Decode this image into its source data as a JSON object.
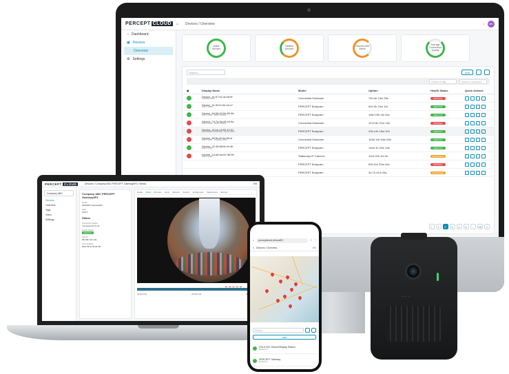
{
  "monitor": {
    "logo_main": "PERCEPT",
    "logo_box": "CLOUD",
    "breadcrumb": "Devices / Overview",
    "avatar": "MK",
    "sidebar": [
      {
        "label": "Dashboard"
      },
      {
        "label": "Devices"
      },
      {
        "label": "Overview"
      },
      {
        "label": "Settings"
      }
    ],
    "cards": [
      {
        "label": "Online Devices",
        "color": "#3fb54a"
      },
      {
        "label": "Healthy Devices",
        "color": "#f0932b"
      },
      {
        "label": "Devices with Alerts",
        "color": "#f0932b"
      },
      {
        "label": "Average Connection Quality",
        "color": "#3fb54a"
      }
    ],
    "search_placeholder": "Search...",
    "add_label": "Add",
    "filter1": "Select a tag",
    "filter2": "Select a product",
    "columns": [
      "Display Name",
      "Model",
      "Uptime",
      "Health Status",
      "Quick Actions"
    ],
    "rows": [
      {
        "name": "Device_e1:67:b1:ad:af:9f",
        "tag": "LOADING DOCK",
        "model": "Connected Dashcam",
        "uptime": "75d 4h 13m 25s",
        "health": "CRITICAL",
        "state": "ok"
      },
      {
        "name": "Device_9c:3f:e3:4e:c8:c7",
        "tag": "NIGHT SHIFT",
        "model": "PERCEPT Bodycam",
        "uptime": "62d 3h 24m 11s",
        "health": "HEALTHY",
        "state": "ok"
      },
      {
        "name": "Device_9d:56:04:5e:82:8b",
        "tag": "NIGHT SHIFT · NIGHT PATROL",
        "model": "PERCEPT Bodycam",
        "uptime": "116d 19h 4m 44s",
        "health": "HEALTHY",
        "state": "ok"
      },
      {
        "name": "Device_7d:7a:3a:d9:c0:9a",
        "tag": "NIGHT SHIFT · NIGHT PATROL",
        "model": "Connected Dashcam",
        "uptime": "107d 6h 21m 15s",
        "health": "CRITICAL",
        "state": "bad"
      },
      {
        "name": "Device_cb:1e:c3:83:10:31",
        "tag": "SECONDARY ENTRANCE · NIGHT SHIFT",
        "model": "PERCEPT Bodycam",
        "uptime": "23d 14h 15m 57s",
        "health": "HEALTHY",
        "state": "bad"
      },
      {
        "name": "Device_89:9a:f2:0a:f8:cd",
        "tag": "NIGHT SHIFT · LOADING DOCK",
        "model": "Connected Dashcam",
        "uptime": "104d 11h 54m 53s",
        "health": "HEALTHY",
        "state": "bad"
      },
      {
        "name": "Device_42:48:68:8c:fe:4b",
        "tag": "NIGHT SHIFT",
        "model": "PERCEPT Bodycam",
        "uptime": "134d 1h 22m 44s",
        "health": "HEALTHY",
        "state": "ok"
      },
      {
        "name": "Device_1a:a8:0a:52:38:96",
        "tag": "NIGHT SHIFT",
        "model": "Stationary IP Camera",
        "uptime": "111d 20h 2m 9s",
        "health": "DEGRADED",
        "state": "bad"
      },
      {
        "name": "",
        "tag": "",
        "model": "PERCEPT Bodycam",
        "uptime": "63d 11h 52m 44s",
        "health": "CRITICAL",
        "state": "none"
      },
      {
        "name": "",
        "tag": "",
        "model": "PERCEPT Bodycam",
        "uptime": "2d 7h 41m 25s",
        "health": "DEGRADED",
        "state": "none"
      }
    ],
    "pages": [
      "<",
      "1",
      "2",
      "3",
      "4",
      "5",
      "...",
      "25",
      ">"
    ],
    "health_colors": {
      "HEALTHY": "#3fb54a",
      "CRITICAL": "#e24a4a",
      "DEGRADED": "#f0a020"
    }
  },
  "laptop": {
    "breadcrumb": "Devices / Company ABC PERCEPT Gateway9F3 / Media",
    "avatar": "SN",
    "company": "Company ABC",
    "sidebar": [
      "Devices",
      "Overview",
      "Tags",
      "Video",
      "Settings"
    ],
    "device_title": "Company ABC PERCEPT Gateway9F3",
    "info_heading": "Status",
    "info": [
      {
        "k": "Model",
        "v": "PERCEPT Gateway9F3"
      },
      {
        "k": "Tags",
        "v": "VAULT"
      },
      {
        "k": "Connection Status",
        "v": "Connected for 5h 13"
      },
      {
        "k": "Health Status",
        "v": "HEALTHY"
      },
      {
        "k": "Uptime",
        "v": "08d 08h 22m 44s"
      },
      {
        "k": "Last updated",
        "v": "2024-05-01 09:46 PM"
      }
    ],
    "tabs": [
      "Details",
      "Media",
      "Firmware",
      "Alerts",
      "Statistics",
      "Network",
      "Configuration",
      "Maintenance",
      "Settings"
    ],
    "timeline": [
      "08:46:30 AM",
      "08:46:40 AM",
      "08:46:50 AM"
    ]
  },
  "phone": {
    "url": "perceptcloud.iefnoutEC",
    "breadcrumb": "Devices / Overview",
    "avatar": "MK",
    "search_placeholder": "Search...",
    "add_label": "Add",
    "devices": [
      {
        "name": "CIN-9-30V Secure/Display Station",
        "sub": "Moved 4 H"
      },
      {
        "name": "PERCEPT Gateway",
        "sub": "Moved 4 H"
      }
    ]
  }
}
